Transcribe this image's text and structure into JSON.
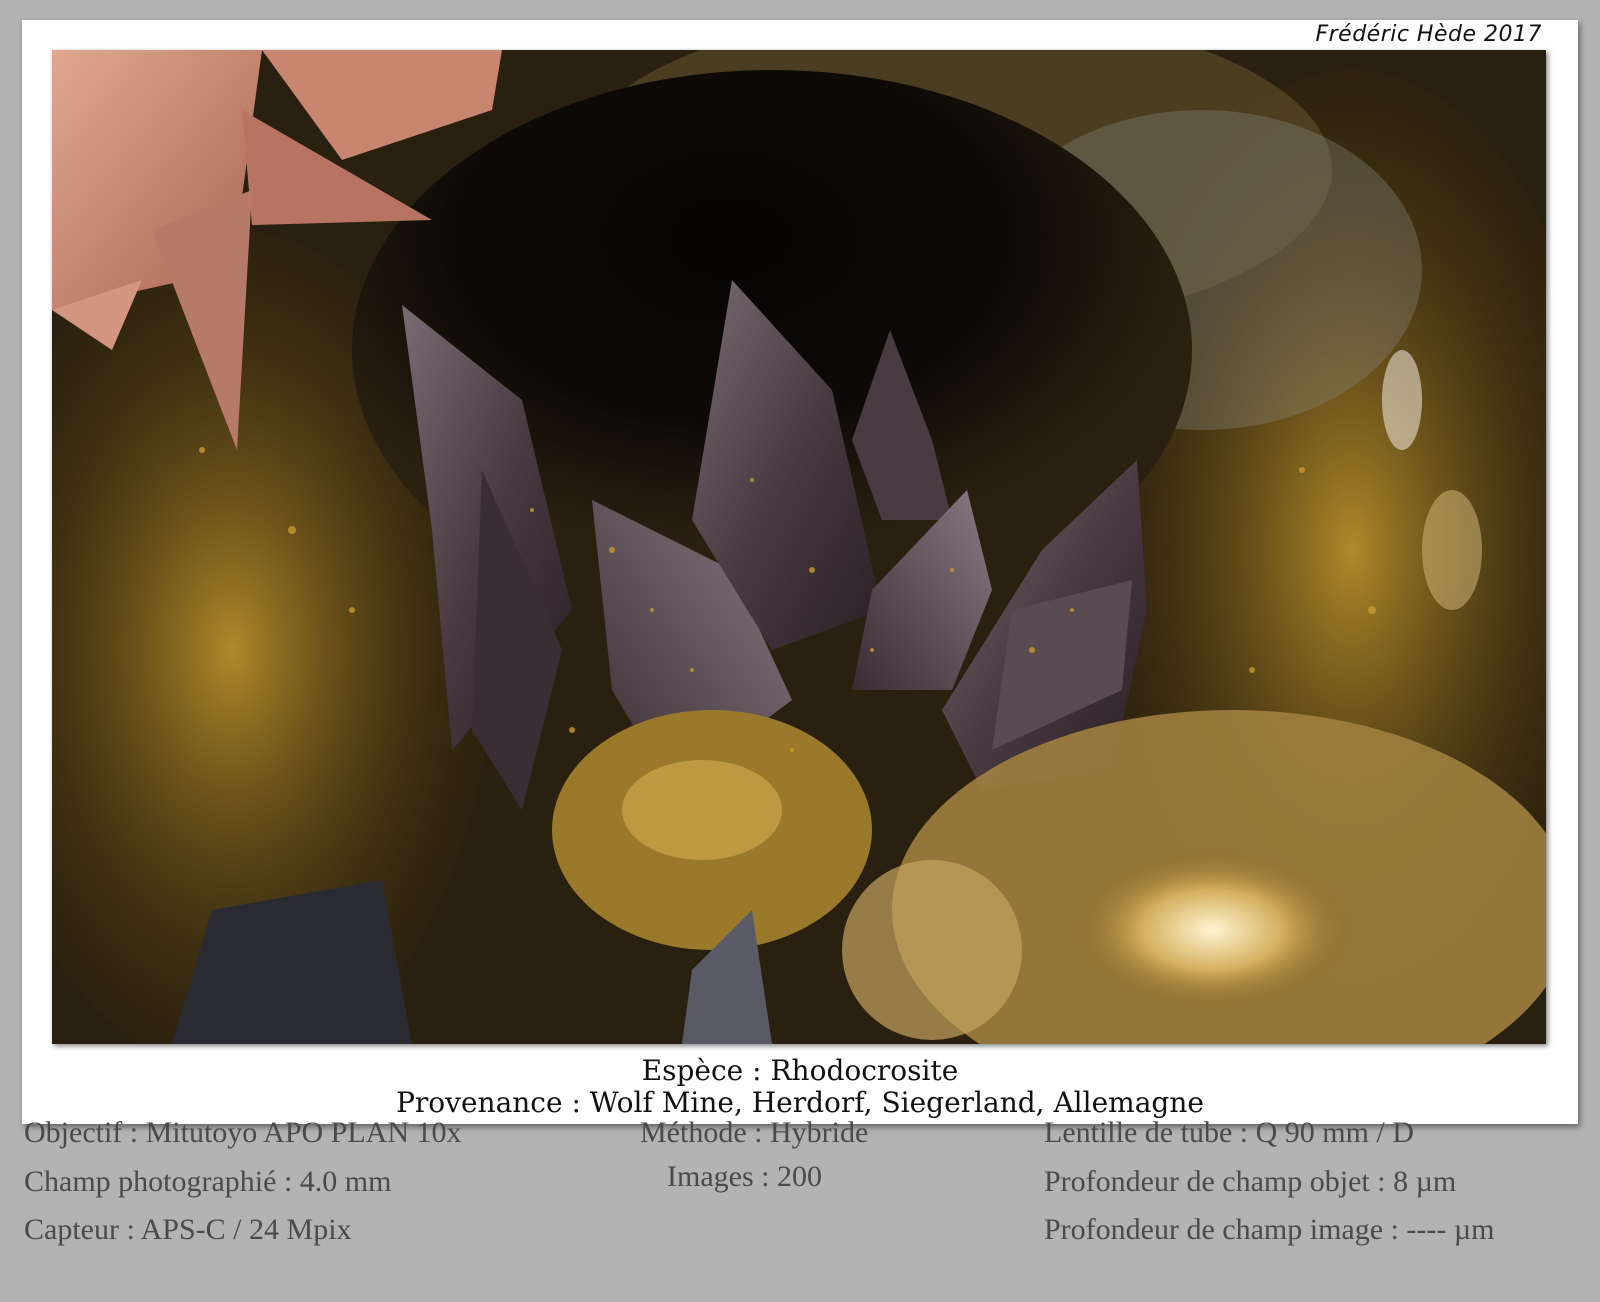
{
  "signature": "Frédéric Hède 2017",
  "caption": {
    "espece": "Espèce : Rhodocrosite",
    "provenance": "Provenance : Wolf Mine, Herdorf, Siegerland, Allemagne"
  },
  "details": {
    "col1": [
      "Objectif : Mitutoyo APO PLAN 10x",
      "Champ photographié : 4.0 mm",
      "Capteur : APS-C / 24 Mpix"
    ],
    "col2": [
      "Méthode : Hybride",
      "Images : 200"
    ],
    "col3": [
      "Lentille de tube : Q 90 mm / D",
      "Profondeur de champ objet : 8 µm",
      "Profondeur de champ image : ---- µm"
    ]
  },
  "colors": {
    "background": "#b3b3b3",
    "card": "#ffffff",
    "crystal_dark": "#4a3a40",
    "crystal_pink": "#c98a72",
    "matrix_ochre": "#8a6a1e"
  }
}
